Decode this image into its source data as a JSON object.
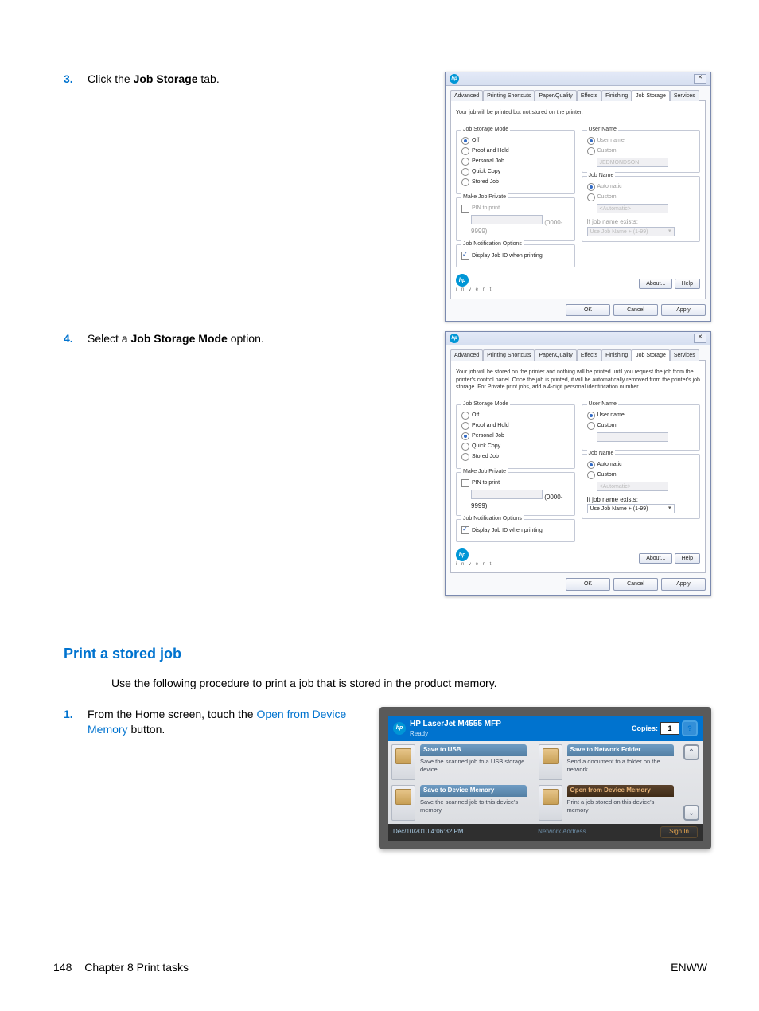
{
  "steps": {
    "s3": {
      "num": "3.",
      "pre": "Click the ",
      "bold": "Job Storage",
      "post": " tab."
    },
    "s4": {
      "num": "4.",
      "pre": "Select a ",
      "bold": "Job Storage Mode",
      "post": " option."
    },
    "s1b": {
      "num": "1.",
      "pre": "From the Home screen, touch the ",
      "link": "Open from Device Memory",
      "post": " button."
    }
  },
  "dialog_common": {
    "titlebar_left_icon": "hp-icon",
    "tabs": [
      "Advanced",
      "Printing Shortcuts",
      "Paper/Quality",
      "Effects",
      "Finishing",
      "Job Storage",
      "Services"
    ],
    "group_jobmode": "Job Storage Mode",
    "modes": {
      "off": "Off",
      "proof": "Proof and Hold",
      "personal": "Personal Job",
      "quick": "Quick Copy",
      "stored": "Stored Job"
    },
    "group_make_private": "Make Job Private",
    "pin_label": "PIN to print",
    "pin_hint": "(0000-9999)",
    "group_notify": "Job Notification Options",
    "display_jobid": "Display Job ID when printing",
    "group_user": "User Name",
    "user_user": "User name",
    "user_custom": "Custom",
    "user_value": "JEDMONDSON",
    "group_jobname": "Job Name",
    "jn_auto": "Automatic",
    "jn_custom": "Custom",
    "jn_value": "<Automatic>",
    "jn_exists": "If job name exists:",
    "jn_exists_sel": "Use Job Name + (1-99)",
    "btns": {
      "about": "About...",
      "help": "Help",
      "ok": "OK",
      "cancel": "Cancel",
      "apply": "Apply"
    },
    "hp_sub": "i n v e n t"
  },
  "dialog3": {
    "desc": "Your job will be printed but not stored on the printer."
  },
  "dialog4": {
    "desc": "Your job will be stored on the printer and nothing will be printed until you request the job from the printer's control panel.  Once the job is printed, it will be automatically removed from the printer's job storage.  For Private print jobs, add a 4-digit personal identification number."
  },
  "section": {
    "heading": "Print a stored job",
    "intro": "Use the following procedure to print a job that is stored in the product memory."
  },
  "panel": {
    "title": "HP LaserJet M4555 MFP",
    "ready": "Ready",
    "copies_label": "Copies:",
    "copies_value": "1",
    "help": "?",
    "save_usb_title": "Save to USB",
    "save_usb_desc": "Save the scanned job to a USB storage device",
    "save_net_title": "Save to Network Folder",
    "save_net_desc": "Send a document to a folder on the network",
    "save_dev_title": "Save to Device Memory",
    "save_dev_desc": "Save the scanned job to this device's memory",
    "open_dev_title": "Open from Device Memory",
    "open_dev_desc": "Print a job stored on this device's memory",
    "date": "Dec/10/2010 4:06:32 PM",
    "netaddr": "Network Address",
    "signin": "Sign In"
  },
  "footer": {
    "page": "148",
    "chapter": "Chapter 8   Print tasks",
    "right": "ENWW"
  }
}
